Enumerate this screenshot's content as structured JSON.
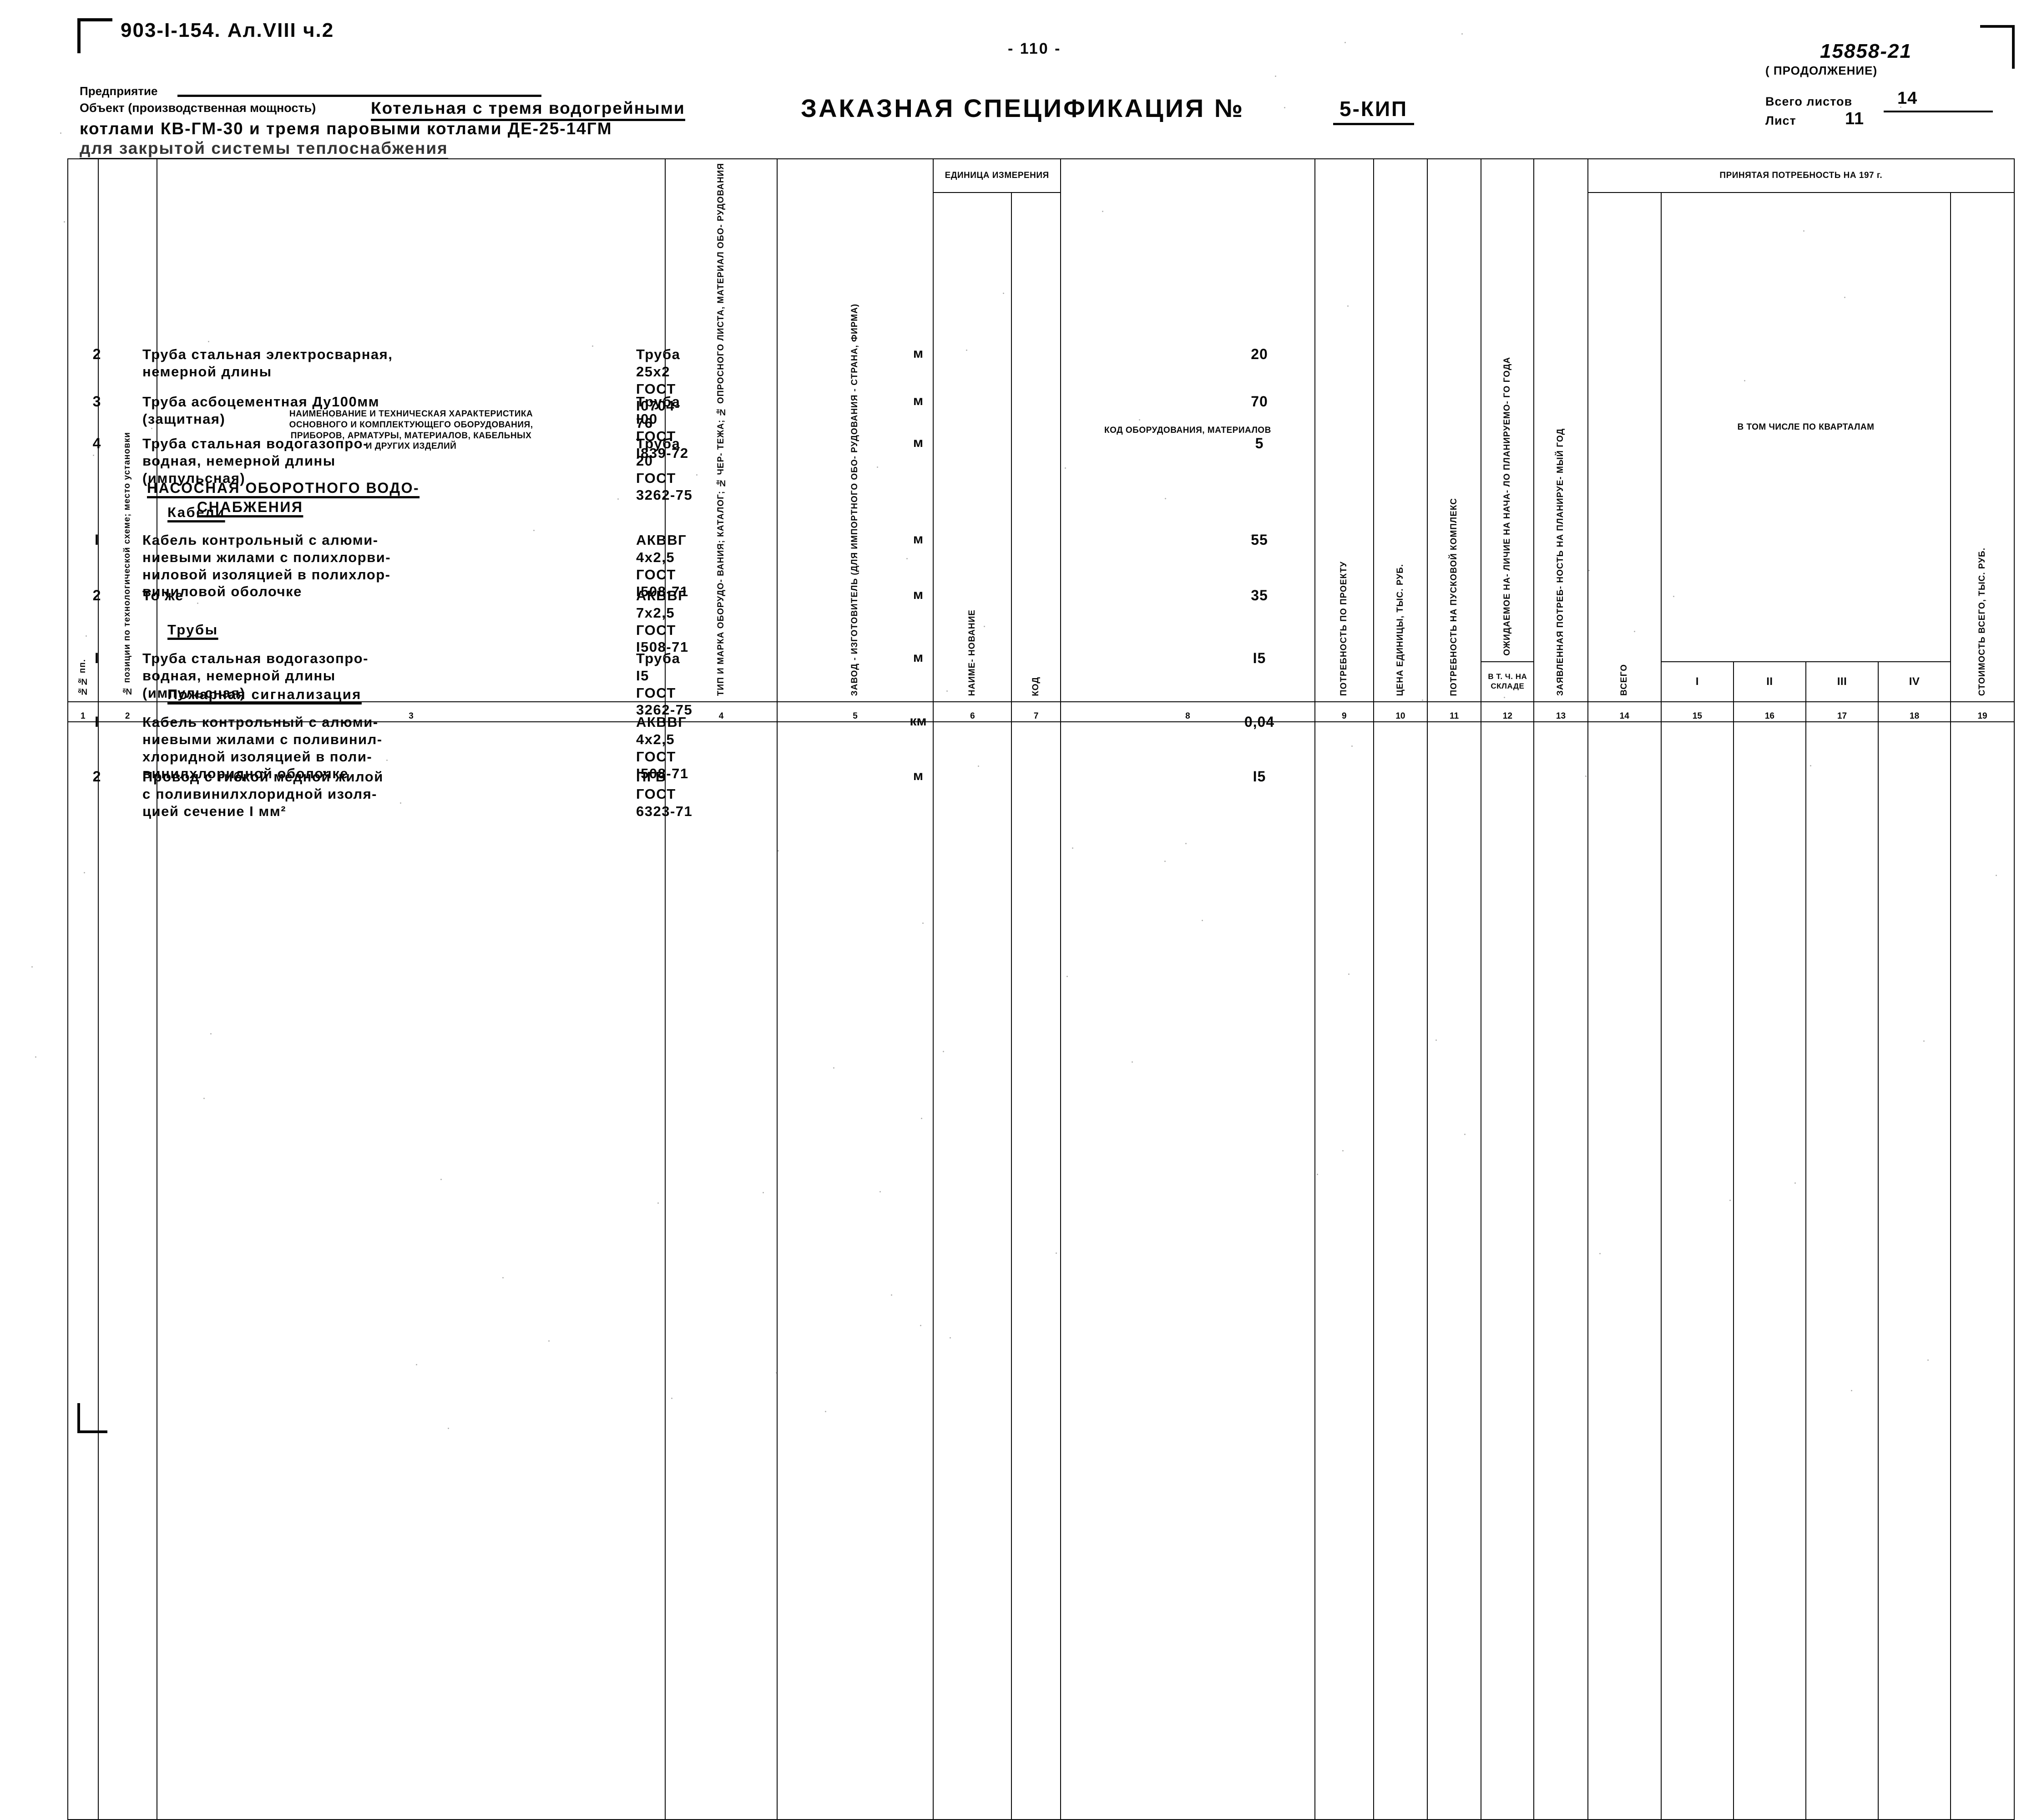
{
  "header": {
    "doc_code": "903-I-154. Ал.VIII ч.2",
    "page_number": "- 110 -",
    "registration_number": "15858-21",
    "enterprise_label": "Предприятие",
    "object_label": "Объект (производственная мощность)",
    "object_line1": "Котельная с тремя водогрейными",
    "object_line2": "котлами КВ-ГМ-30 и тремя паровыми котлами ДЕ-25-14ГМ",
    "object_line3": "для закрытой системы теплоснабжения",
    "title": "ЗАКАЗНАЯ СПЕЦИФИКАЦИЯ №",
    "title_number": "5-КИП",
    "continuation": "( ПРОДОЛЖЕНИЕ)",
    "total_sheets_label": "Всего листов",
    "total_sheets_value": "14",
    "sheet_label": "Лист",
    "sheet_value": "11"
  },
  "table": {
    "columns": {
      "c1": "№№ пп.",
      "c2": "№ позиции по технологической схеме; место установки",
      "c3": "Наименование и техническая характеристика основного и комплектующего оборудования, приборов, арматуры, материалов, кабельных и других изделий",
      "c3_lines": [
        "НАИМЕНОВАНИЕ И ТЕХНИЧЕСКАЯ  ХАРАКТЕРИСТИКА",
        "ОСНОВНОГО И КОМПЛЕКТУЮЩЕГО ОБОРУДОВАНИЯ,",
        "ПРИБОРОВ, АРМАТУРЫ, МАТЕРИАЛОВ, КАБЕЛЬНЫХ",
        "И ДРУГИХ ИЗДЕЛИЙ"
      ],
      "c4": "ТИП И МАРКА ОБОРУДО- ВАНИЯ; КАТАЛОГ; № ЧЕР- ТЕЖА; № ОПРОСНОГО ЛИСТА, МАТЕРИАЛ ОБО- РУДОВАНИЯ",
      "c5": "ЗАВОД - ИЗГОТОВИТЕЛЬ (ДЛЯ ИМПОРТНОГО ОБО- РУДОВАНИЯ - СТРАНА, ФИРМА)",
      "c6_7_group": "ЕДИНИЦА ИЗМЕРЕНИЯ",
      "c6": "НАИМЕ- НОВАНИЕ",
      "c7": "КОД",
      "c8": "КОД ОБОРУДОВАНИЯ, МАТЕРИАЛОВ",
      "c9": "ПОТРЕБНОСТЬ ПО ПРОЕКТУ",
      "c10": "ЦЕНА ЕДИНИЦЫ, ТЫС. РУБ.",
      "c11": "ПОТРЕБНОСТЬ НА ПУСКОВОЙ КОМПЛЕКС",
      "c12": "ОЖИДАЕМОЕ НА- ЛИЧИЕ НА НАЧА- ЛО ПЛАНИРУЕМО- ГО ГОДА",
      "c12b": "В Т. Ч. НА СКЛАДЕ",
      "c13": "ЗАЯВЛЕННАЯ ПОТРЕБ- НОСТЬ НА ПЛАНИРУЕ- МЫЙ ГОД",
      "c_accepted_group": "ПРИНЯТАЯ  ПОТРЕБНОСТЬ  НА  197        г.",
      "c14": "ВСЕГО",
      "c_quarters_group": "В ТОМ ЧИСЛЕ ПО КВАРТАЛАМ",
      "c15": "I",
      "c16": "II",
      "c17": "III",
      "c18": "IV",
      "c19": "СТОИМОСТЬ ВСЕГО, ТЫС. РУБ."
    },
    "column_numbers": [
      "1",
      "2",
      "3",
      "4",
      "5",
      "6",
      "7",
      "8",
      "9",
      "10",
      "11",
      "12",
      "13",
      "14",
      "15",
      "16",
      "17",
      "18",
      "19"
    ],
    "rows": [
      {
        "kind": "item",
        "num": "2",
        "name": [
          "Труба стальная электросварная,",
          "немерной длины"
        ],
        "type": [
          "Труба",
          "25х2",
          "ГОСТ",
          "I0704-",
          "76"
        ],
        "unit": "м",
        "qty": "20"
      },
      {
        "kind": "item",
        "num": "3",
        "name": [
          "Труба асбоцементная Ду100мм",
          "(защитная)"
        ],
        "type": [
          "Труба",
          "I00",
          "ГОСТ",
          "I839-72"
        ],
        "unit": "м",
        "qty": "70"
      },
      {
        "kind": "item",
        "num": "4",
        "name": [
          "Труба стальная водогазопро-",
          "водная, немерной длины",
          "(импульсная)"
        ],
        "type": [
          "Труба",
          "20",
          "ГОСТ",
          "3262-75"
        ],
        "unit": "м",
        "qty": "5"
      },
      {
        "kind": "section",
        "lines": [
          "НАСОСНАЯ ОБОРОТНОГО ВОДО-",
          "СНАБЖЕНИЯ"
        ]
      },
      {
        "kind": "subsection",
        "lines": [
          "Кабели"
        ]
      },
      {
        "kind": "item",
        "num": "I",
        "name": [
          "Кабель контрольный с алюми-",
          "ниевыми жилами с полихлорви-",
          "ниловой изоляцией в полихлор-",
          "виниловой оболочке"
        ],
        "type": [
          "АКВВГ",
          "4х2,5",
          "ГОСТ",
          "I508-71"
        ],
        "unit": "м",
        "qty": "55"
      },
      {
        "kind": "item",
        "num": "2",
        "name": [
          "То же"
        ],
        "type": [
          "АКВВГ",
          "7х2,5",
          "ГОСТ",
          "I508-71"
        ],
        "unit": "м",
        "qty": "35"
      },
      {
        "kind": "subsection",
        "lines": [
          "Трубы"
        ]
      },
      {
        "kind": "item",
        "num": "I",
        "name": [
          "Труба стальная водогазопро-",
          "водная, немерной длины",
          "(импульсная)"
        ],
        "type": [
          "Труба",
          "I5",
          "ГОСТ",
          "3262-75"
        ],
        "unit": "м",
        "qty": "I5"
      },
      {
        "kind": "subsection",
        "lines": [
          "Пожарная сигнализация"
        ]
      },
      {
        "kind": "item",
        "num": "I",
        "name": [
          "Кабель контрольный с алюми-",
          "ниевыми жилами с поливинил-",
          "хлоридной изоляцией в поли-",
          "винилхлоридной оболочке"
        ],
        "type": [
          "АКВВГ",
          "4х2,5",
          "ГОСТ",
          "I508-71"
        ],
        "unit": "км",
        "qty": "0,04"
      },
      {
        "kind": "item",
        "num": "2",
        "name": [
          "Провод с гибкой медной жилой",
          "с поливинилхлоридной изоля-",
          "цией сечение I мм²"
        ],
        "type": [
          "ПГВ",
          "ГОСТ",
          "6323-71"
        ],
        "unit": "м",
        "qty": "I5"
      }
    ]
  }
}
